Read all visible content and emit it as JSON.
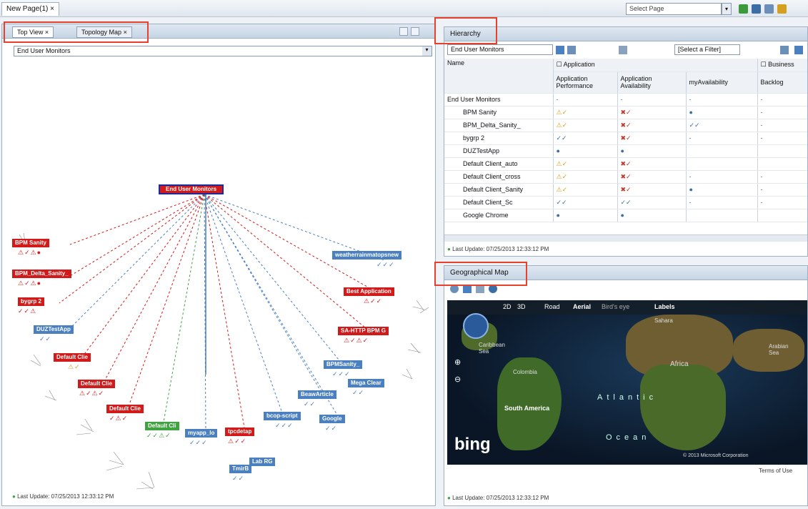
{
  "topbar": {
    "page_tab": "New Page(1)",
    "page_tab_close": "×",
    "select_page": "Select Page",
    "select_arrow": "▾",
    "icons": [
      "refresh-icon",
      "save-icon",
      "layout-icon",
      "help-icon"
    ]
  },
  "left_panel": {
    "tabs": [
      {
        "label": "Top View",
        "close": "×"
      },
      {
        "label": "Topology Map",
        "close": "×"
      }
    ],
    "view_select": "End User Monitors",
    "view_select_arrow": "▾",
    "root_node": "End User Monitors",
    "nodes_left": [
      {
        "label": "BPM Sanity",
        "color": "red",
        "icons": "⚠✓⚠●"
      },
      {
        "label": "BPM_Delta_Sanity_",
        "color": "red",
        "icons": "⚠✓⚠●"
      },
      {
        "label": "bygrp 2",
        "color": "red",
        "icons": "✓✓⚠"
      },
      {
        "label": "DUZTestApp",
        "color": "blue",
        "icons": "✓✓"
      },
      {
        "label": "Default Clie",
        "color": "red",
        "icons": "⚠✓"
      },
      {
        "label": "Default Clie",
        "color": "red",
        "icons": "⚠✓⚠✓"
      },
      {
        "label": "Default Clie",
        "color": "red",
        "icons": "✓⚠✓"
      }
    ],
    "nodes_bottom": [
      {
        "label": "Default Cli",
        "color": "green",
        "icons": "✓✓⚠✓"
      },
      {
        "label": "myapp_lo",
        "color": "blue",
        "icons": "✓✓✓"
      },
      {
        "label": "tpcdetap",
        "color": "red",
        "icons": "⚠✓✓"
      },
      {
        "label": "Lab RG",
        "color": "blue",
        "icons": "✓✓"
      },
      {
        "label": "TmirB",
        "color": "blue",
        "icons": "✓✓"
      },
      {
        "label": "bcop-script",
        "color": "blue",
        "icons": "✓✓✓"
      }
    ],
    "nodes_right": [
      {
        "label": "weatherrainmatopsnew",
        "color": "blue",
        "icons": "✓✓✓"
      },
      {
        "label": "Best Application",
        "color": "red",
        "icons": "⚠✓✓"
      },
      {
        "label": "SA-HTTP BPM G",
        "color": "red",
        "icons": "⚠✓⚠✓"
      },
      {
        "label": "BPMSanity_",
        "color": "blue",
        "icons": "✓✓✓"
      },
      {
        "label": "Mega Clear",
        "color": "blue",
        "icons": "✓✓"
      },
      {
        "label": "BeawArticle",
        "color": "blue",
        "icons": "✓✓"
      },
      {
        "label": "Google",
        "color": "blue",
        "icons": "✓✓"
      }
    ],
    "footer": "Last Update: 07/25/2013 12:33:12 PM"
  },
  "hierarchy": {
    "title": "Hierarchy",
    "view_select": "End User Monitors",
    "filter_select": "[Select a Filter]",
    "columns": {
      "name": "Name",
      "group_application": "Application",
      "group_business": "Business",
      "app_performance": "Application Performance",
      "app_availability": "Application Availability",
      "my_availability": "myAvailability",
      "backlog": "Backlog"
    },
    "rows": [
      {
        "name": "End User Monitors",
        "indent": 0,
        "perf": "-",
        "avail": "-",
        "myav": "-",
        "back": "-"
      },
      {
        "name": "BPM Sanity",
        "indent": 1,
        "perf": "⚠✓",
        "avail": "✖✓",
        "myav": "●",
        "back": "-"
      },
      {
        "name": "BPM_Delta_Sanity_",
        "indent": 1,
        "perf": "⚠✓",
        "avail": "✖✓",
        "myav": "✓✓",
        "back": "-"
      },
      {
        "name": "bygrp 2",
        "indent": 1,
        "perf": "✓✓",
        "avail": "✖✓",
        "myav": "-",
        "back": "-"
      },
      {
        "name": "DUZTestApp",
        "indent": 1,
        "perf": "●",
        "avail": "●",
        "myav": "",
        "back": ""
      },
      {
        "name": "Default Client_auto",
        "indent": 1,
        "perf": "⚠✓",
        "avail": "✖✓",
        "myav": "",
        "back": ""
      },
      {
        "name": "Default Client_cross",
        "indent": 1,
        "perf": "⚠✓",
        "avail": "✖✓",
        "myav": "-",
        "back": "-"
      },
      {
        "name": "Default Client_Sanity",
        "indent": 1,
        "perf": "⚠✓",
        "avail": "✖✓",
        "myav": "●",
        "back": "-"
      },
      {
        "name": "Default Client_Sc",
        "indent": 1,
        "perf": "✓✓",
        "avail": "✓✓",
        "myav": "-",
        "back": "-"
      },
      {
        "name": "Google Chrome",
        "indent": 1,
        "perf": "●",
        "avail": "●",
        "myav": "",
        "back": ""
      }
    ],
    "footer": "Last Update: 07/25/2013 12:33:12 PM"
  },
  "geo": {
    "title": "Geographical Map",
    "map_nav": [
      "2D",
      "3D",
      "Road",
      "Aerial",
      "Bird's eye",
      "Labels"
    ],
    "labels": [
      "Sahara",
      "Caribbean Sea",
      "Colombia",
      "Africa",
      "Arabian Sea",
      "South America",
      "Atlantic",
      "Ocean"
    ],
    "brand": "bing",
    "copyright": "© 2013 Microsoft Corporation",
    "terms": "Terms of Use",
    "footer": "Last Update: 07/25/2013 12:33:12 PM"
  }
}
